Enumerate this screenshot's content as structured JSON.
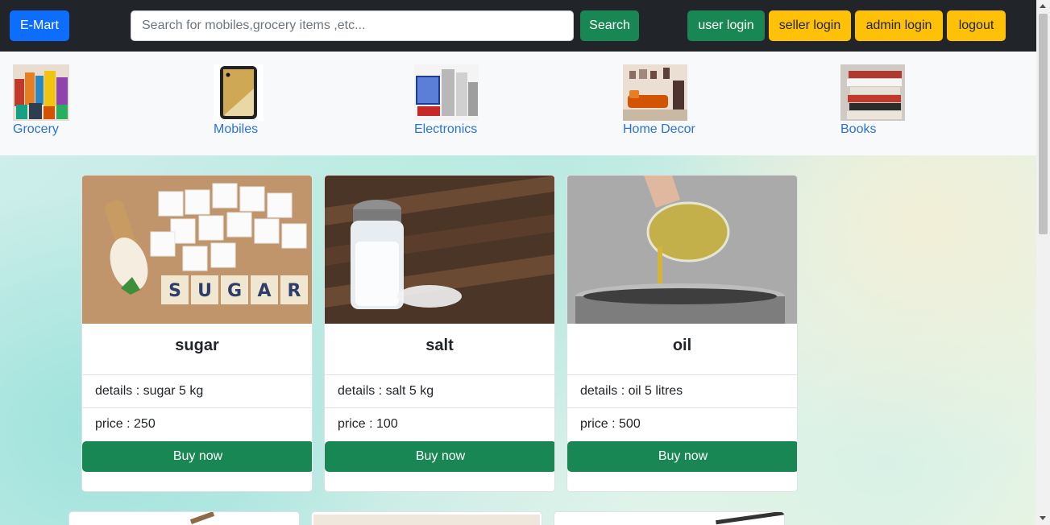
{
  "navbar": {
    "brand": "E-Mart",
    "search_placeholder": "Search for mobiles,grocery items ,etc...",
    "search_button": "Search",
    "user_login": "user login",
    "seller_login": "seller login",
    "admin_login": "admin login",
    "logout": "logout"
  },
  "categories": [
    {
      "label": "Grocery"
    },
    {
      "label": "Mobiles"
    },
    {
      "label": "Electronics"
    },
    {
      "label": "Home Decor"
    },
    {
      "label": "Books"
    }
  ],
  "products": [
    {
      "name": "sugar",
      "details": "details : sugar 5 kg",
      "price": "price : 250",
      "buy_label": "Buy now",
      "image_text": "SUGAR"
    },
    {
      "name": "salt",
      "details": "details : salt 5 kg",
      "price": "price : 100",
      "buy_label": "Buy now"
    },
    {
      "name": "oil",
      "details": "details : oil 5 litres",
      "price": "price : 500",
      "buy_label": "Buy now"
    }
  ],
  "colors": {
    "navbar_bg": "#212529",
    "brand_blue": "#0d6efd",
    "success_green": "#198754",
    "warning_yellow": "#ffc107",
    "link_blue": "#2a73d9"
  }
}
